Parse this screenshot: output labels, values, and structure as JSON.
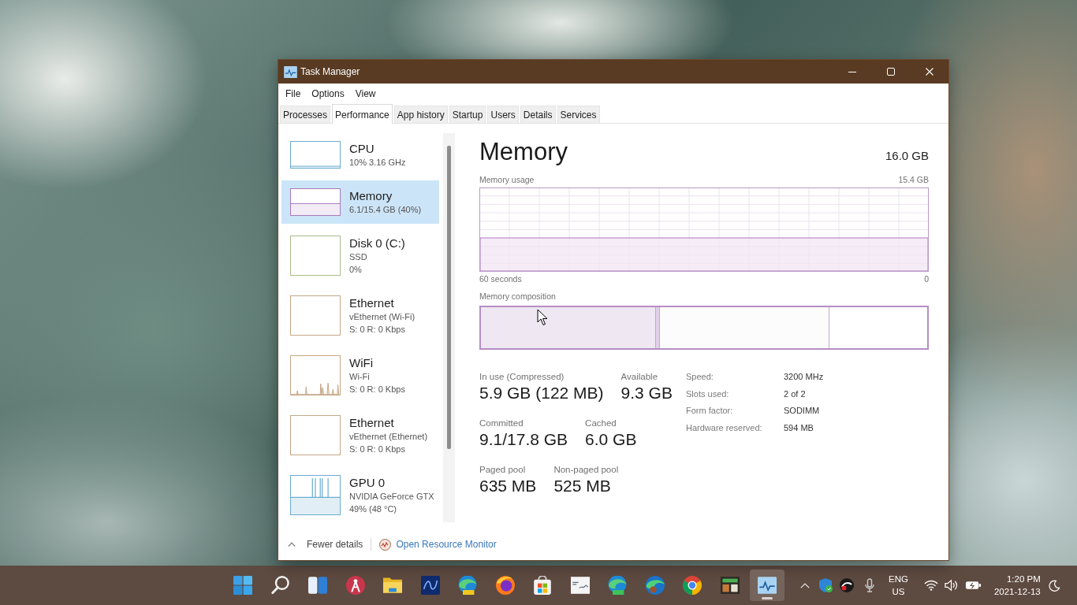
{
  "window": {
    "title": "Task Manager"
  },
  "menu": [
    "File",
    "Options",
    "View"
  ],
  "tabs": [
    {
      "label": "Processes",
      "selected": false
    },
    {
      "label": "Performance",
      "selected": true
    },
    {
      "label": "App history",
      "selected": false
    },
    {
      "label": "Startup",
      "selected": false
    },
    {
      "label": "Users",
      "selected": false
    },
    {
      "label": "Details",
      "selected": false
    },
    {
      "label": "Services",
      "selected": false
    }
  ],
  "sidebar": {
    "items": [
      {
        "name": "CPU",
        "lines": [
          "10% 3.16 GHz"
        ],
        "kind": "baseline",
        "color": "#6aaccf",
        "selected": false
      },
      {
        "name": "Memory",
        "lines": [
          "6.1/15.4 GB (40%)"
        ],
        "kind": "fill",
        "color": "#a77bbd",
        "selected": true
      },
      {
        "name": "Disk 0 (C:)",
        "lines": [
          "SSD",
          "0%"
        ],
        "kind": "empty",
        "color": "#a9bb8a",
        "selected": false
      },
      {
        "name": "Ethernet",
        "lines": [
          "vEthernet (Wi-Fi)",
          "S: 0 R: 0 Kbps"
        ],
        "kind": "empty",
        "color": "#c4a784",
        "selected": false
      },
      {
        "name": "WiFi",
        "lines": [
          "Wi-Fi",
          "S: 0 R: 0 Kbps"
        ],
        "kind": "spikes",
        "color": "#c4a784",
        "selected": false
      },
      {
        "name": "Ethernet",
        "lines": [
          "vEthernet (Ethernet)",
          "S: 0 R: 0 Kbps"
        ],
        "kind": "empty",
        "color": "#c4a784",
        "selected": false
      },
      {
        "name": "GPU 0",
        "lines": [
          "NVIDIA GeForce GTX",
          "49% (48 °C)"
        ],
        "kind": "pulses",
        "color": "#6aaccf",
        "selected": false
      }
    ]
  },
  "detail": {
    "title": "Memory",
    "total": "16.0 GB",
    "usage_label": "Memory usage",
    "usage_max": "15.4 GB",
    "time_start": "60 seconds",
    "time_end": "0",
    "composition_label": "Memory composition",
    "composition": [
      {
        "kind": "in_use",
        "level": 0.39
      },
      {
        "kind": "modified",
        "level": 0.01
      },
      {
        "kind": "standby"
      },
      {
        "kind": "free",
        "level": 0.22
      }
    ]
  },
  "stats": [
    [
      {
        "label": "In use (Compressed)",
        "value": "5.9 GB (122 MB)"
      },
      {
        "label": "Available",
        "value": "9.3 GB"
      }
    ],
    [
      {
        "label": "Committed",
        "value": "9.1/17.8 GB"
      },
      {
        "label": "Cached",
        "value": "6.0 GB"
      }
    ],
    [
      {
        "label": "Paged pool",
        "value": "635 MB"
      },
      {
        "label": "Non-paged pool",
        "value": "525 MB"
      }
    ]
  ],
  "specs": [
    {
      "label": "Speed:",
      "value": "3200 MHz"
    },
    {
      "label": "Slots used:",
      "value": "2 of 2"
    },
    {
      "label": "Form factor:",
      "value": "SODIMM"
    },
    {
      "label": "Hardware reserved:",
      "value": "594 MB"
    }
  ],
  "footer": {
    "fewer_details": "Fewer details",
    "resource_monitor": "Open Resource Monitor"
  },
  "taskbar": {
    "apps": [
      {
        "selected": false
      },
      {
        "selected": false
      },
      {
        "selected": false
      },
      {
        "selected": false
      },
      {
        "selected": false
      },
      {
        "selected": false
      },
      {
        "selected": false
      },
      {
        "selected": false
      },
      {
        "selected": false
      },
      {
        "selected": false
      },
      {
        "selected": false
      },
      {
        "selected": false
      },
      {
        "selected": false
      },
      {
        "selected": false
      },
      {
        "selected": true
      }
    ],
    "language": [
      "ENG",
      "US"
    ],
    "time": "1:20 PM",
    "date": "2021-12-13"
  }
}
